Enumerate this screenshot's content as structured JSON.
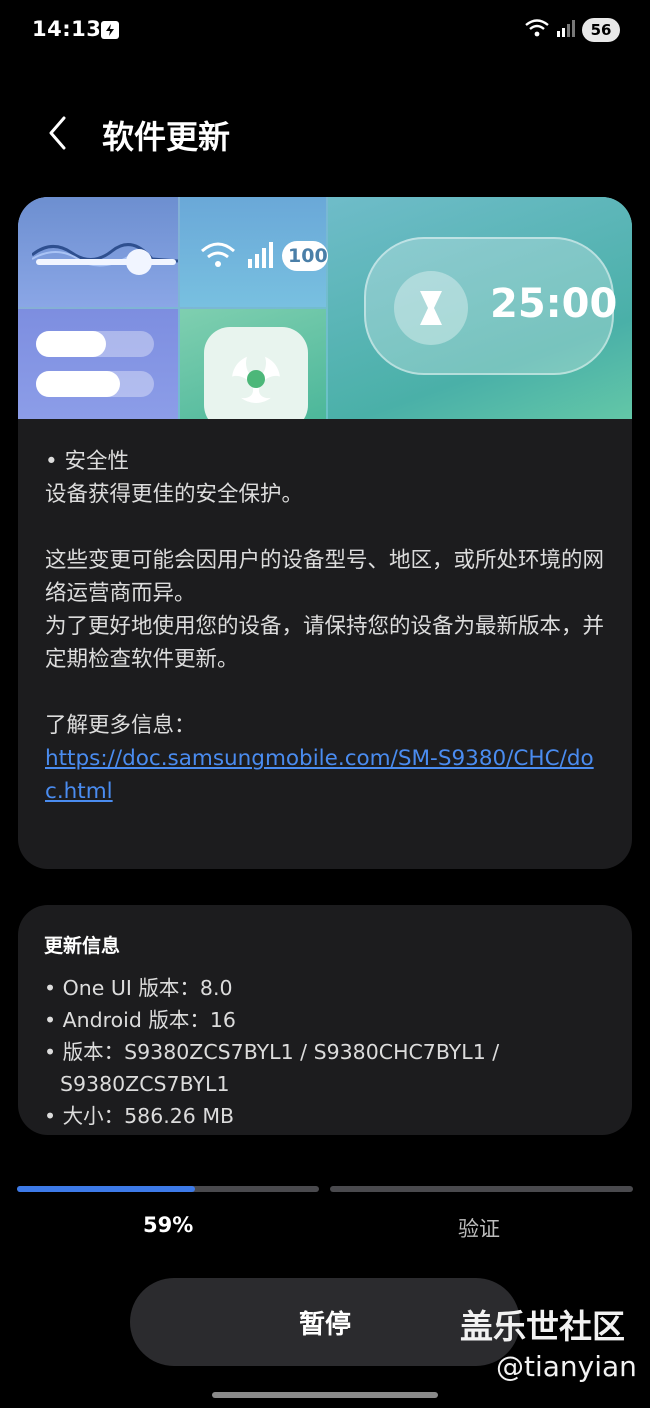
{
  "status_bar": {
    "time": "14:13",
    "battery": "56"
  },
  "header": {
    "title": "软件更新"
  },
  "banner": {
    "timer": "25:00",
    "battery_text": "100"
  },
  "notes": {
    "heading": "• 安全性",
    "line1": "设备获得更佳的安全保护。",
    "para2": "这些变更可能会因用户的设备型号、地区，或所处环境的网络运营商而异。\n为了更好地使用您的设备，请保持您的设备为最新版本，并定期检查软件更新。",
    "learn_more": "了解更多信息：",
    "link": "https://doc.samsungmobile.com/SM-S9380/CHC/doc.html"
  },
  "update_info": {
    "title": "更新信息",
    "one_ui": "• One UI 版本：8.0",
    "android": "• Android 版本：16",
    "version": "• 版本：S9380ZCS7BYL1 / S9380CHC7BYL1 /",
    "version_cont": "S9380ZCS7BYL1",
    "size": "• 大小：586.26 MB"
  },
  "progress": {
    "percent_label": "59%",
    "percent": 59,
    "verify_label": "验证"
  },
  "pause_button": {
    "label": "暂停"
  },
  "watermark": {
    "brand": "盖乐世社区",
    "handle": "@tianyian"
  },
  "colors": {
    "accent": "#3d7ae8",
    "link": "#4a8cf0",
    "card": "#1c1c1e"
  }
}
